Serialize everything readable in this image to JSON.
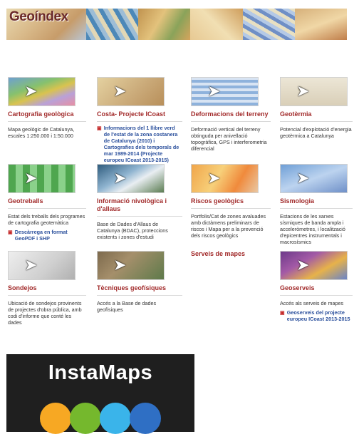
{
  "banner": {
    "logo": "Geoíndex",
    "thumbs": [
      "map-thumb-1",
      "map-thumb-2",
      "map-thumb-3",
      "map-thumb-4",
      "map-thumb-5"
    ]
  },
  "cards": {
    "cartografia": {
      "title": "Cartografia geològica",
      "desc": "Mapa geològic de Catalunya, escales 1:250.000 i 1:50.000"
    },
    "costa": {
      "title": "Costa- Projecte ICoast",
      "link": "Informacions del 1 llibre verd de l'estat de la zona costanera de Catalunya (2010) i Cartografies dels temporals de mar 1989-2014 (Projecte europeu ICoast 2013-2015)"
    },
    "deformacions": {
      "title": "Deformacions del terreny",
      "desc": "Deformació vertical del terreny obtinguda per anivellació topogràfica, GPS i interferometria diferencial"
    },
    "geotermia": {
      "title": "Geotèrmia",
      "desc": "Potencial d'explotació d'energia geotèrmica a Catalunya"
    },
    "geotreballs": {
      "title": "Geotreballs",
      "desc": "Estat dels treballs dels programes de cartografia geotemàtica",
      "link": "Descàrrega en format GeoPDF i SHP"
    },
    "nivologica": {
      "title": "Informació nivològica i d'allaus",
      "desc": "Base de Dades d'Allaus de Catalunya (BDAC), proteccions existents i zones d'estudi"
    },
    "riscos": {
      "title": "Riscos geològics",
      "desc": "Portfolis/Cat de zones avaluades amb dictàmens preliminars de riscos i Mapa per a la prevenció dels riscos geològics"
    },
    "sismologia": {
      "title": "Sismologia",
      "desc": "Estacions de les xarxes sísmiques de banda ampla i acceleròmetres, i localització d'epicentres instrumentals i macrosísmics"
    },
    "sondejos": {
      "title": "Sondejos",
      "desc": "Ubicació de sondejos provinents de projectes d'obra pública, amb codi d'informe que conté les dades"
    },
    "tecniques": {
      "title": "Tècniques geofísiques",
      "desc": "Accés a la Base de dades geofísiques"
    },
    "geoserveis": {
      "title": "Geoserveis",
      "desc": "Accés als serveis de mapes",
      "link": "Geoserveis del projecte europeu ICoast 2013-2015"
    }
  },
  "serveis_heading": "Serveis de mapes",
  "pdf_icon": "pdf-icon",
  "instamaps": {
    "name": "InstaMaps",
    "dot_colors": [
      "#f7a823",
      "#75b82d",
      "#3ab4ea",
      "#2f6fc4"
    ]
  }
}
